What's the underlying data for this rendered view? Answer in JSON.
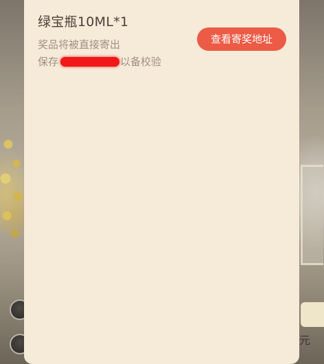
{
  "prize": {
    "title": "绿宝瓶10ML*1",
    "delivery_note": "奖品将被直接寄出",
    "keep_prefix": "保存",
    "keep_suffix": "以备校验"
  },
  "actions": {
    "view_address_label": "查看寄奖地址"
  },
  "background": {
    "currency_glyph": "元"
  },
  "colors": {
    "modal_bg": "#f6ead8",
    "button_bg": "#ec5b45",
    "title_text": "#4b4037",
    "muted_text": "#9e9183",
    "redaction": "#f01818"
  }
}
